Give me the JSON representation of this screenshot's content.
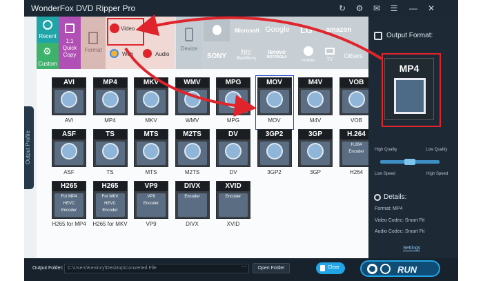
{
  "app": {
    "title": "WonderFox DVD Ripper Pro"
  },
  "titlebar": {
    "icons": [
      "refresh-icon",
      "gear-icon",
      "message-icon",
      "menu-icon",
      "minimize-icon",
      "close-icon"
    ],
    "glyphs": [
      "↻",
      "⚙",
      "✉",
      "☰",
      "—",
      "✕"
    ]
  },
  "sidebar": {
    "output_profile_label": "Output Profile"
  },
  "categories": {
    "recent": "Recent",
    "custom": "Custom",
    "quick_copy": "1:1\nQuick\nCopy",
    "format": "Format",
    "video": "Video",
    "web": "Web",
    "audio": "Audio",
    "device": "Device"
  },
  "brands": [
    "Microsoft",
    "Google",
    "LG",
    "amazon",
    "SONY",
    "htc",
    "lenovo",
    "HUAWEI",
    "TV",
    "Others"
  ],
  "brand_subtext": {
    "htc": "BlackBerry",
    "lenovo": "MOTOROLA"
  },
  "formats": [
    {
      "header": "AVI",
      "label": "AVI"
    },
    {
      "header": "MP4",
      "label": "MP4"
    },
    {
      "header": "MKV",
      "label": "MKV"
    },
    {
      "header": "WMV",
      "label": "WMV"
    },
    {
      "header": "MPG",
      "label": "MPG"
    },
    {
      "header": "MOV",
      "label": "MOV"
    },
    {
      "header": "M4V",
      "label": "M4V"
    },
    {
      "header": "VOB",
      "label": "VOB"
    },
    {
      "header": "ASF",
      "label": "ASF"
    },
    {
      "header": "TS",
      "label": "TS"
    },
    {
      "header": "MTS",
      "label": "MTS"
    },
    {
      "header": "M2TS",
      "label": "M2TS"
    },
    {
      "header": "DV",
      "label": "DV"
    },
    {
      "header": "3GP2",
      "label": "3GP2"
    },
    {
      "header": "3GP",
      "label": "3GP"
    },
    {
      "header": "H.264",
      "label": "H264"
    },
    {
      "header": "H265",
      "label": "H265 for MP4"
    },
    {
      "header": "H265",
      "label": "H265 for MKV"
    },
    {
      "header": "VP9",
      "label": "VP9"
    },
    {
      "header": "DIVX",
      "label": "DIVX"
    },
    {
      "header": "XVID",
      "label": "XVID"
    }
  ],
  "tile_subtext": {
    "h265_mp4": [
      "For MP4",
      "HEVC",
      "Encoder"
    ],
    "h265_mkv": [
      "For MKV",
      "HEVC",
      "Encoder"
    ],
    "h264": [
      "H.264",
      "Encoder"
    ],
    "vp9": [
      "VP9",
      "Encoder"
    ],
    "divx": [
      "Encoder"
    ],
    "xvid": [
      "Encoder"
    ]
  },
  "selected_format": "MOV",
  "right": {
    "output_format_title": "Output Format:",
    "current_format": "MP4",
    "high_quality": "High Quality",
    "low_quality": "Low Quality",
    "low_speed": "Low Speed",
    "high_speed": "High Speed",
    "details_title": "Details:",
    "format_line": "Format: MP4",
    "video_codec": "Video Codec: Smart Fit",
    "audio_codec": "Audio Codec: Smart Fit",
    "settings": "Settings"
  },
  "bottom": {
    "output_folder_label": "Output Folder:",
    "output_folder_path": "C:\\Users\\Kevincy\\Desktop\\Converted File",
    "more": "···",
    "open_folder": "Open Folder",
    "clear": "Clear",
    "run": "RUN"
  },
  "colors": {
    "accent": "#20a5e6",
    "annotation": "#e0242b",
    "selected_outline": "#2b49c9"
  }
}
